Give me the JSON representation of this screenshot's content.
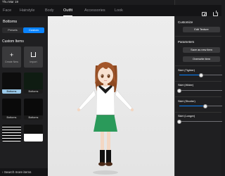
{
  "status": {
    "time": "Thu Mar 19"
  },
  "nav": {
    "tabs": [
      "Face",
      "Hairstyle",
      "Body",
      "Outfit",
      "Accessories",
      "Look"
    ],
    "active": "Outfit"
  },
  "left": {
    "title": "Bottoms",
    "segment": [
      "Presets",
      "Custom"
    ],
    "custom_title": "Custom Items",
    "create_label": "Create New",
    "import_label": "Import",
    "items": [
      "Bottoms",
      "Bottoms",
      "Bottoms",
      "Bottoms",
      "",
      "Bottoms"
    ],
    "search_more": "Search more items"
  },
  "right": {
    "customize_title": "Customize",
    "edit_texture": "Edit Texture",
    "parameters_title": "Parameters",
    "save_new": "Save as new item",
    "overwrite": "Overwrite item",
    "sliders": [
      {
        "label": "Skirt (Tighter)",
        "value": 0.5
      },
      {
        "label": "Skirt (Wider)",
        "value": 0.0
      },
      {
        "label": "Skirt (Shorter)",
        "value": 0.6
      },
      {
        "label": "Skirt (Longer)",
        "value": 0.0
      }
    ]
  },
  "colors": {
    "accent": "#0a84ff",
    "skirt": "#2a9a5a",
    "hair": "#a3562a"
  }
}
